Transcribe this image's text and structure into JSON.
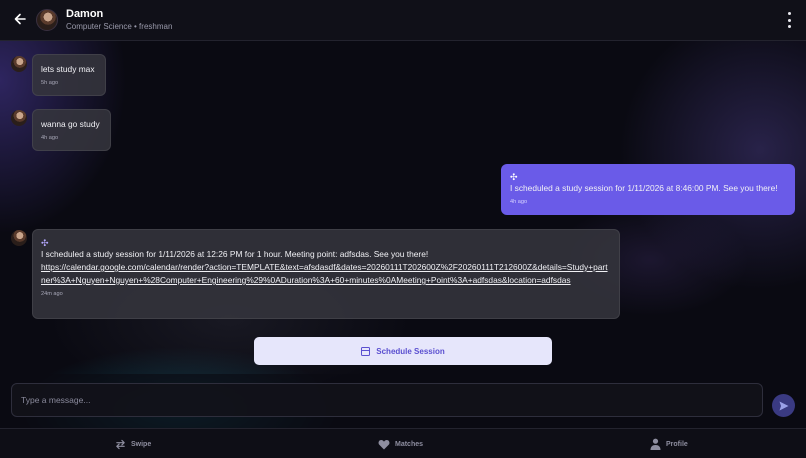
{
  "header": {
    "name": "Damon",
    "subtitle": "Computer Science • freshman"
  },
  "messages": [
    {
      "direction": "incoming",
      "text": "lets study max",
      "time": "5h ago"
    },
    {
      "direction": "incoming",
      "text": "wanna go study",
      "time": "4h ago"
    },
    {
      "direction": "outgoing",
      "icon": "study-tool-icon",
      "text": "I scheduled a study session for 1/11/2026 at 8:46:00 PM. See you there!",
      "time": "4h ago"
    },
    {
      "direction": "incoming",
      "icon": "study-tool-icon",
      "text": "I scheduled a study session for 1/11/2026 at 12:26 PM for 1 hour. Meeting point: adfsdas. See you there!",
      "link": "https://calendar.google.com/calendar/render?action=TEMPLATE&text=afsdasdf&dates=20260111T202600Z%2F20260111T212600Z&details=Study+partner%3A+Nguyen+Nguyen+%28Computer+Engineering%29%0ADuration%3A+60+minutes%0AMeeting+Point%3A+adfsdas&location=adfsdas",
      "time": "24m ago"
    }
  ],
  "schedule_button": {
    "label": "Schedule Session"
  },
  "composer": {
    "placeholder": "Type a message...",
    "value": ""
  },
  "nav": {
    "swipe": "Swipe",
    "matches": "Matches",
    "profile": "Profile"
  },
  "colors": {
    "accent": "#6a5be8",
    "schedule_button_bg": "#e6e6fb",
    "schedule_button_text": "#5a4fd0"
  }
}
